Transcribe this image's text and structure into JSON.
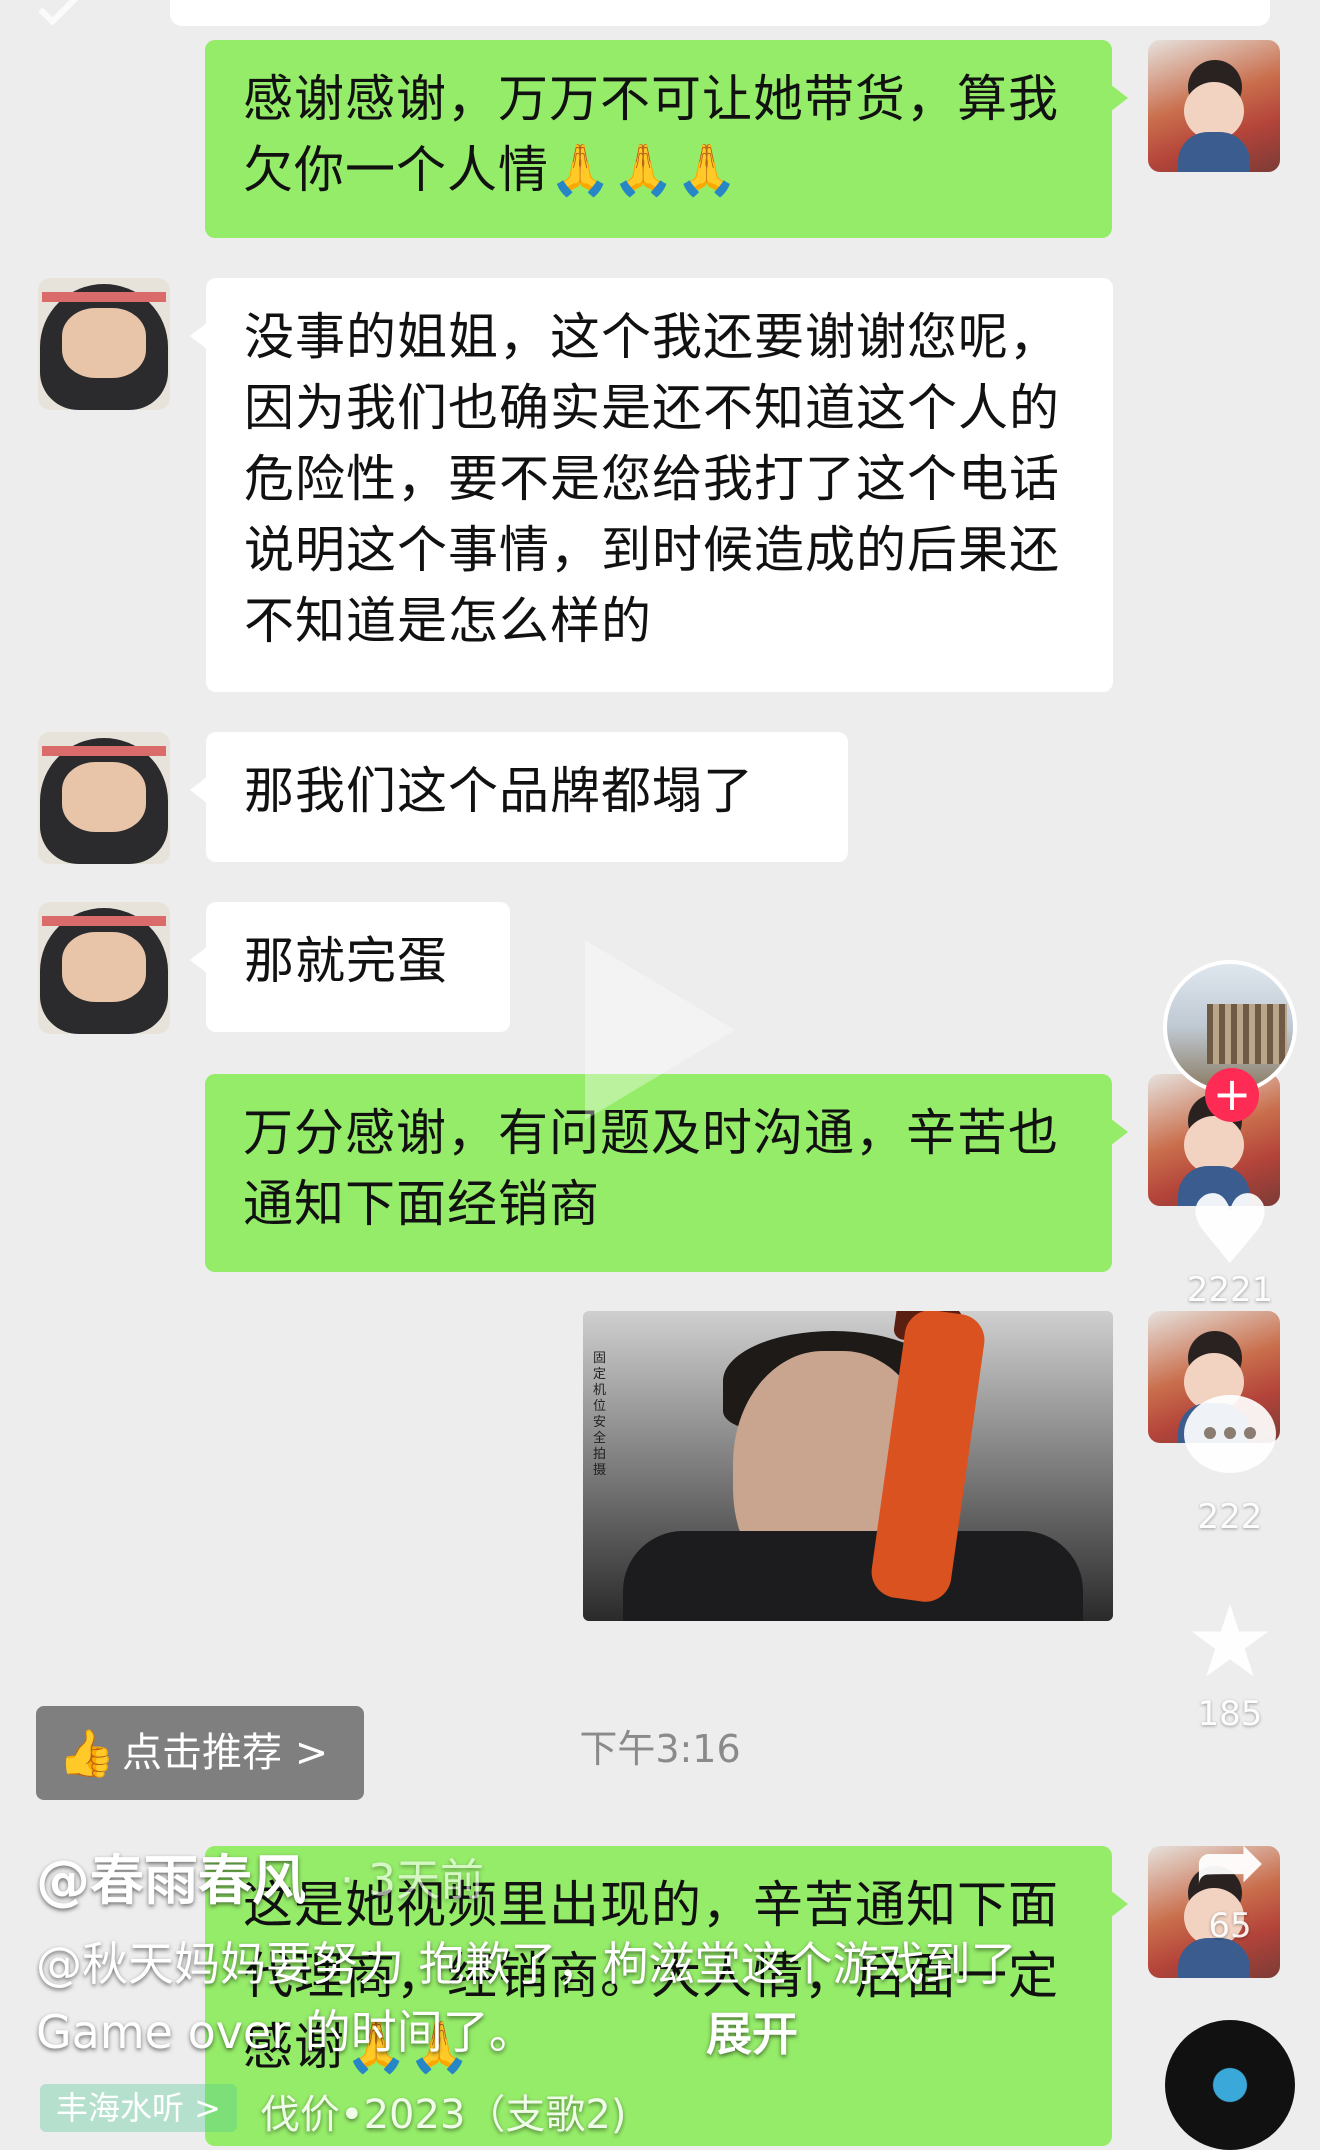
{
  "messages": [
    {
      "side": "right",
      "text": "感谢感谢，万万不可让她带货，算我欠你一个人情🙏🙏🙏"
    },
    {
      "side": "left",
      "text": "没事的姐姐，这个我还要谢谢您呢，因为我们也确实是还不知道这个人的危险性，要不是您给我打了这个电话说明这个事情，到时候造成的后果还不知道是怎么样的"
    },
    {
      "side": "left",
      "text": "那我们这个品牌都塌了"
    },
    {
      "side": "left",
      "text": "那就完蛋"
    },
    {
      "side": "right",
      "text": "万分感谢，有问题及时沟通，辛苦也通知下面经销商"
    },
    {
      "side": "right",
      "text": "这是她视频里出现的，辛苦通知下面代理商，经销商。大人情，后面一定感谢🙏🙏"
    }
  ],
  "video_thumb": {
    "caption": "固定机位 安全拍摄"
  },
  "timestamp": "下午3:16",
  "sidebar": {
    "likes": "2221",
    "comments": "222",
    "favorites": "185",
    "shares": "65"
  },
  "recommend_button": "点击推荐 >",
  "author": "@春雨春风",
  "posted": "· 3天前",
  "description": "@秋天妈妈要努力 抱歉了，枸滋堂这个游戏到了 Game over 的时间了。",
  "expand": "展开",
  "music": "伐价•2023（支歌2)",
  "tag": "丰海水听 >",
  "colors": {
    "my_bubble": "#95ec69",
    "their_bubble": "#ffffff",
    "bg": "#ededed",
    "follow": "#fe2c55"
  }
}
